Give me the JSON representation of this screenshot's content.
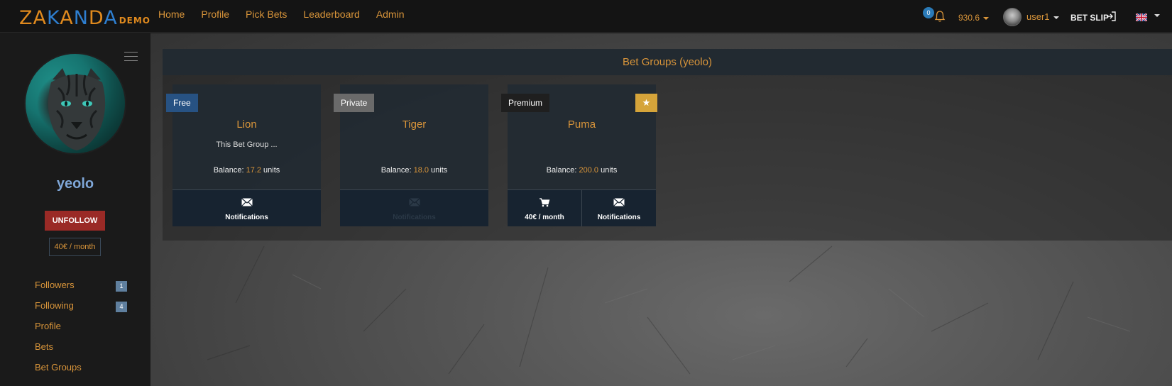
{
  "app": {
    "logo_text": "ZAKANDA",
    "logo_badge": "DEMO"
  },
  "nav": {
    "links": [
      "Home",
      "Profile",
      "Pick Bets",
      "Leaderboard",
      "Admin"
    ],
    "notification_count": "0",
    "balance": "930.6",
    "user_name": "user1",
    "bet_slip_label": "BET SLIP",
    "language": "en-gb"
  },
  "sidebar": {
    "profile_name": "yeolo",
    "unfollow_label": "UNFOLLOW",
    "subscription_price": "40€ / month",
    "menu": [
      {
        "label": "Followers",
        "count": "1"
      },
      {
        "label": "Following",
        "count": "4"
      },
      {
        "label": "Profile",
        "count": ""
      },
      {
        "label": "Bets",
        "count": ""
      },
      {
        "label": "Bet Groups",
        "count": ""
      }
    ]
  },
  "main": {
    "panel_title": "Bet Groups (yeolo)",
    "cards": [
      {
        "tag": "Free",
        "tag_color": "#275283",
        "title": "Lion",
        "description": "This Bet Group ...",
        "balance_prefix": "Balance: ",
        "balance_value": "17.2",
        "balance_suffix": " units",
        "actions": [
          {
            "label": "Notifications",
            "icon": "envelope-icon",
            "enabled": true
          }
        ]
      },
      {
        "tag": "Private",
        "tag_color": "#6a6a6a",
        "title": "Tiger",
        "description": "",
        "balance_prefix": "Balance: ",
        "balance_value": "18.0",
        "balance_suffix": " units",
        "actions": [
          {
            "label": "Notifications",
            "icon": "envelope-icon",
            "enabled": false
          }
        ]
      },
      {
        "tag": "Premium",
        "tag_color": "#1f1f1f",
        "starred": true,
        "title": "Puma",
        "description": "",
        "balance_prefix": "Balance: ",
        "balance_value": "200.0",
        "balance_suffix": " units",
        "actions": [
          {
            "label": "40€ / month",
            "icon": "cart-icon",
            "enabled": true
          },
          {
            "label": "Notifications",
            "icon": "envelope-icon",
            "enabled": true
          }
        ]
      }
    ]
  },
  "colors": {
    "accent": "#d9953a",
    "profile_name": "#7fa7d8",
    "unfollow": "#9a2a26",
    "star": "#d5a43a"
  }
}
